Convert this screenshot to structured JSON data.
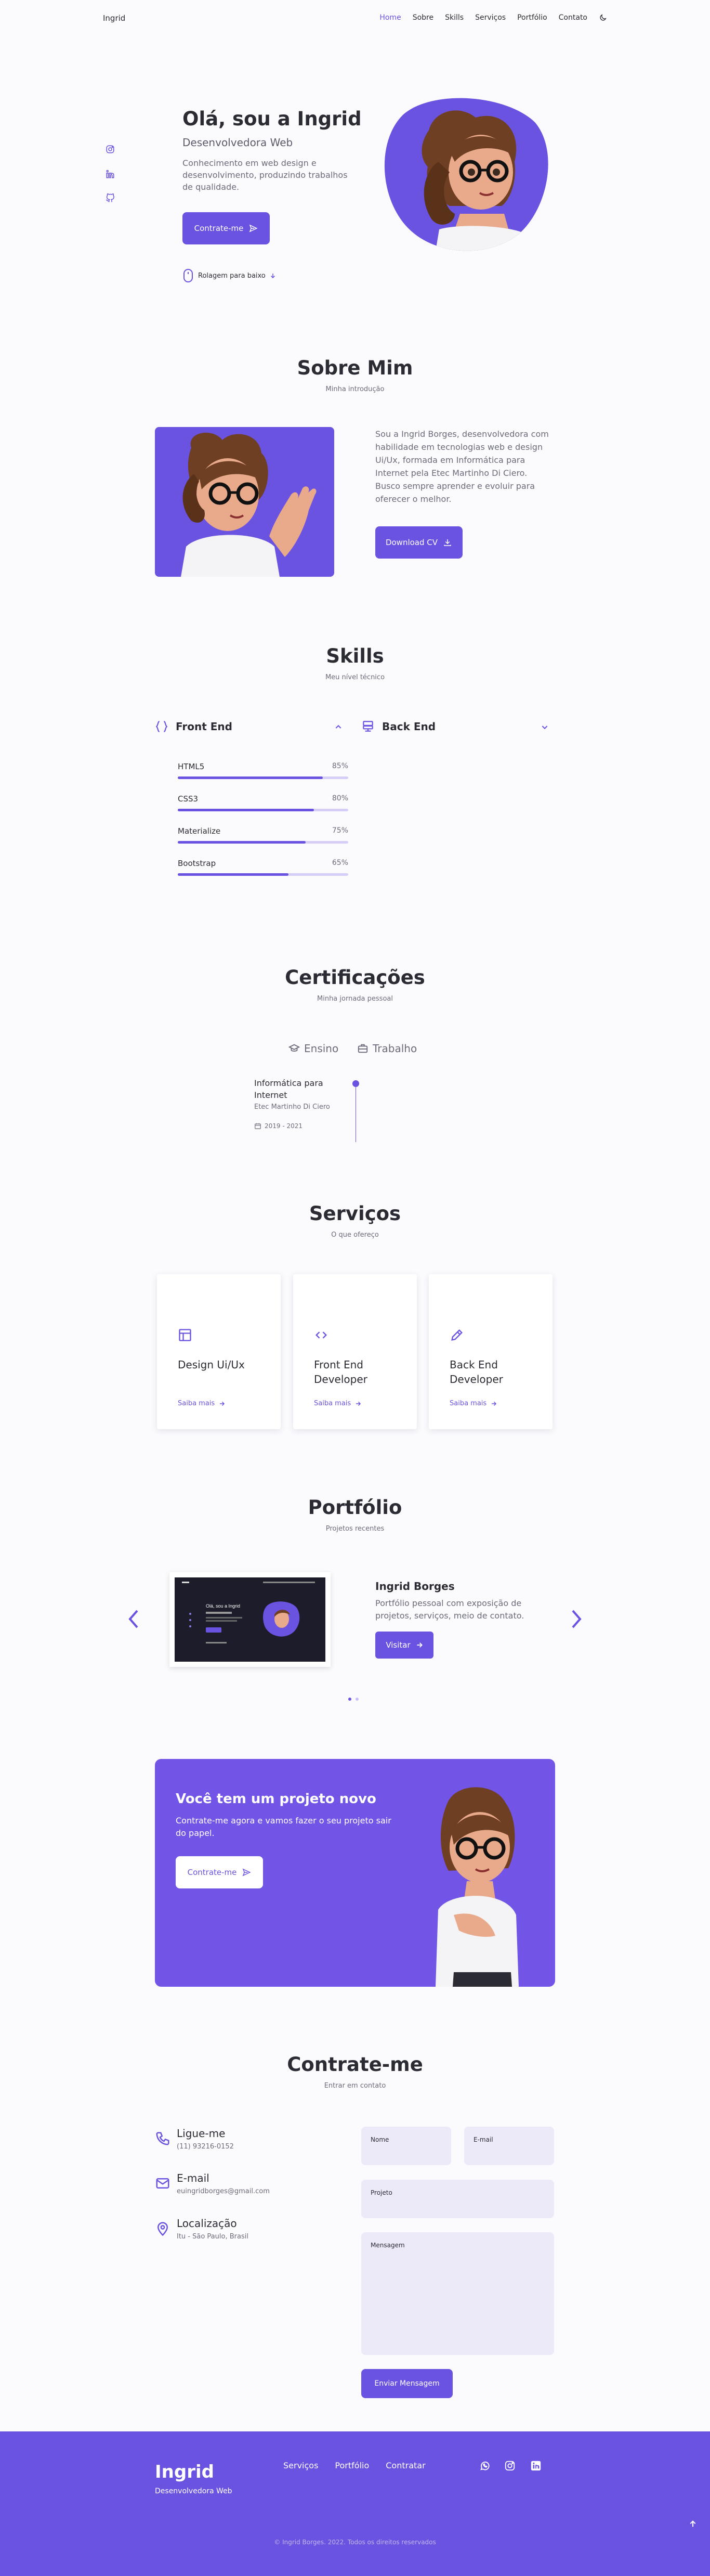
{
  "header": {
    "logo": "Ingrid",
    "nav": [
      "Home",
      "Sobre",
      "Skills",
      "Serviços",
      "Portfólio",
      "Contato"
    ],
    "theme_icon": "moon-icon"
  },
  "hero": {
    "title": "Olá, sou a Ingrid",
    "subtitle": "Desenvolvedora Web",
    "description": "Conhecimento em web design e desenvolvimento, produzindo trabalhos de qualidade.",
    "cta": "Contrate-me",
    "scroll": "Rolagem para baixo",
    "social_icons": [
      "instagram-icon",
      "linkedin-icon",
      "github-icon"
    ]
  },
  "about": {
    "title": "Sobre Mim",
    "subtitle": "Minha introdução",
    "text": "Sou a Ingrid Borges, desenvolvedora com habilidade em tecnologias web e design Ui/Ux, formada em Informática para Internet pela Etec Martinho Di Ciero. Busco sempre aprender e evoluir para oferecer o melhor.",
    "download": "Download CV"
  },
  "skills": {
    "title": "Skills",
    "subtitle": "Meu nível técnico",
    "groups": [
      "Front End",
      "Back End"
    ],
    "items": [
      {
        "name": "HTML5",
        "pct": "85%",
        "level": 85
      },
      {
        "name": "CSS3",
        "pct": "80%",
        "level": 80
      },
      {
        "name": "Materialize",
        "pct": "75%",
        "level": 75
      },
      {
        "name": "Bootstrap",
        "pct": "65%",
        "level": 65
      }
    ]
  },
  "certs": {
    "title": "Certificações",
    "subtitle": "Minha jornada pessoal",
    "tabs": [
      "Ensino",
      "Trabalho"
    ],
    "item": {
      "title": "Informática para Internet",
      "school": "Etec Martinho Di Ciero",
      "date": "2019 - 2021"
    }
  },
  "services": {
    "title": "Serviços",
    "subtitle": "O que ofereço",
    "cards": [
      {
        "title": "Design Ui/Ux",
        "more": "Saiba mais"
      },
      {
        "title": "Front End Developer",
        "more": "Saiba mais"
      },
      {
        "title": "Back End Developer",
        "more": "Saiba mais"
      }
    ]
  },
  "portfolio": {
    "title": "Portfólio",
    "subtitle": "Projetos recentes",
    "project_title": "Ingrid Borges",
    "project_desc": "Portfólio pessoal com exposição de projetos, serviços, meio de contato.",
    "visit": "Visitar",
    "shot_title": "Olá, sou a Ingrid"
  },
  "cta": {
    "title": "Você tem um projeto novo",
    "desc": "Contrate-me agora e vamos fazer o seu projeto sair do papel.",
    "btn": "Contrate-me"
  },
  "contact": {
    "title": "Contrate-me",
    "subtitle": "Entrar em contato",
    "items": [
      {
        "title": "Ligue-me",
        "value": "(11) 93216-0152"
      },
      {
        "title": "E-mail",
        "value": "euingridborges@gmail.com"
      },
      {
        "title": "Localização",
        "value": "Itu - São Paulo, Brasil"
      }
    ],
    "fields": {
      "name": "Nome",
      "email": "E-mail",
      "project": "Projeto",
      "message": "Mensagem"
    },
    "send": "Enviar Mensagem"
  },
  "footer": {
    "logo": "Ingrid",
    "sub": "Desenvolvedora Web",
    "links": [
      "Serviços",
      "Portfólio",
      "Contratar"
    ],
    "icons": [
      "whatsapp-icon",
      "instagram-icon",
      "linkedin-icon"
    ],
    "copy": "© Ingrid Borges. 2022. Todos os direitos reservados"
  },
  "colors": {
    "primary": "#6a53e0",
    "primary_light": "#eeebfb",
    "background": "#fbfbfe"
  }
}
